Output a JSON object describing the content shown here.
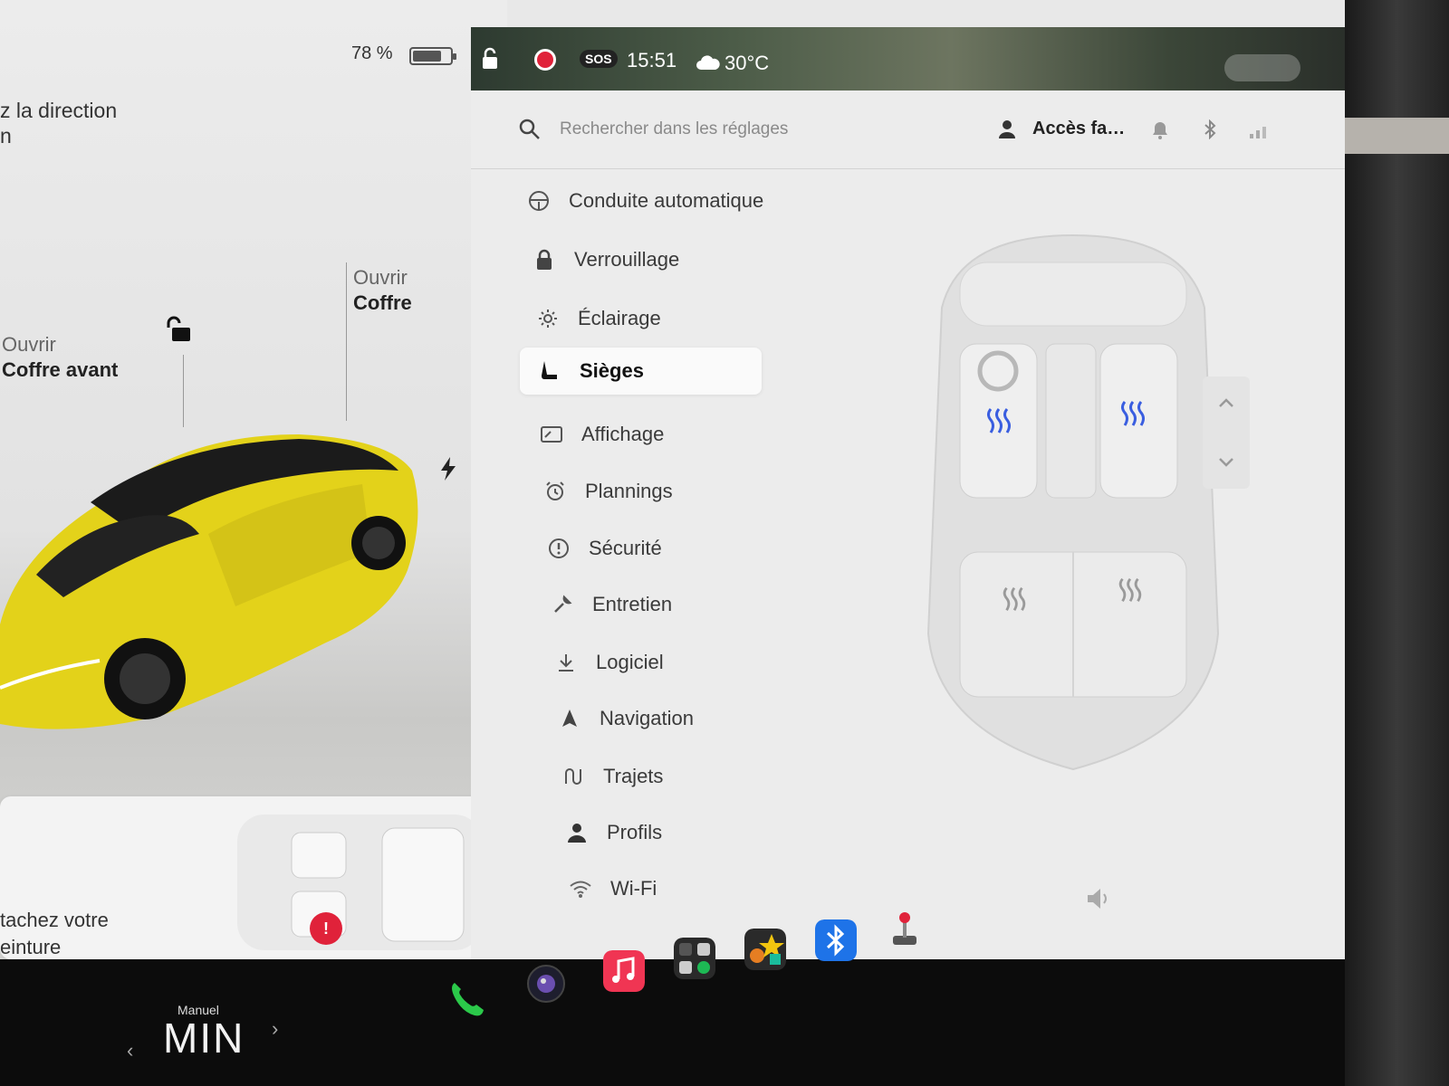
{
  "vehicle": {
    "battery_percent_text": "78 %",
    "battery_level": 0.78,
    "steering_hint_line1": "z la direction",
    "steering_hint_line2": "n",
    "trunk": {
      "action": "Ouvrir",
      "target": "Coffre"
    },
    "frunk": {
      "action": "Ouvrir",
      "target": "Coffre avant"
    },
    "seatbelt_warning_line1": "tachez votre",
    "seatbelt_warning_line2": "einture",
    "car_color": "#e3d21a"
  },
  "status_bar": {
    "sos_label": "SOS",
    "time": "15:51",
    "temperature": "30°C",
    "recording_color": "#e0223a"
  },
  "settings_header": {
    "search_placeholder": "Rechercher dans les réglages",
    "profile_label": "Accès fa…"
  },
  "menu": {
    "items": [
      {
        "label": "Conduite automatique",
        "icon": "steering-wheel-icon"
      },
      {
        "label": "Verrouillage",
        "icon": "lock-icon"
      },
      {
        "label": "Éclairage",
        "icon": "sun-icon"
      },
      {
        "label": "Sièges",
        "icon": "seat-icon"
      },
      {
        "label": "Affichage",
        "icon": "display-icon"
      },
      {
        "label": "Plannings",
        "icon": "alarm-clock-icon"
      },
      {
        "label": "Sécurité",
        "icon": "alert-circle-icon"
      },
      {
        "label": "Entretien",
        "icon": "wrench-icon"
      },
      {
        "label": "Logiciel",
        "icon": "download-icon"
      },
      {
        "label": "Navigation",
        "icon": "navigation-arrow-icon"
      },
      {
        "label": "Trajets",
        "icon": "trips-icon"
      },
      {
        "label": "Profils",
        "icon": "person-icon"
      },
      {
        "label": "Wi-Fi",
        "icon": "wifi-icon"
      }
    ],
    "selected": "Sièges"
  },
  "seat_heating": {
    "front_left": "on",
    "front_right": "on",
    "rear_left": "off",
    "rear_right": "off",
    "active_color": "#3a5ee0"
  },
  "dock": {
    "gear_mode": "Manuel",
    "gear_value": "MIN",
    "apps": [
      "phone-icon",
      "camera-icon",
      "music-icon",
      "apps-launcher-icon",
      "toybox-icon",
      "bluetooth-icon",
      "joystick-icon"
    ]
  }
}
